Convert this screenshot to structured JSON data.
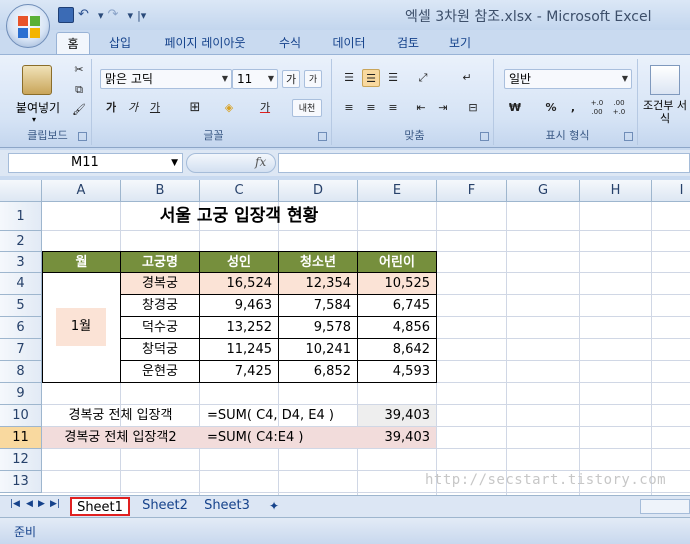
{
  "window": {
    "title": "엑셀 3차원 참조.xlsx - Microsoft Excel"
  },
  "ribbon_tabs": [
    {
      "label": "홈"
    },
    {
      "label": "삽입"
    },
    {
      "label": "페이지 레이아웃"
    },
    {
      "label": "수식"
    },
    {
      "label": "데이터"
    },
    {
      "label": "검토"
    },
    {
      "label": "보기"
    }
  ],
  "ribbon": {
    "clipboard": {
      "paste_label": "붙여넣기",
      "group_label": "클립보드"
    },
    "font": {
      "font_name": "맑은 고딕",
      "font_size": "11",
      "group_label": "글꼴",
      "bold": "가",
      "italic": "가",
      "underline": "가",
      "grow": "가",
      "shrink": "가",
      "phonetic": "내천"
    },
    "alignment": {
      "group_label": "맞춤"
    },
    "number": {
      "format": "일반",
      "group_label": "표시 형식",
      "currency": "₩",
      "percent": "%",
      "comma": ",",
      "inc_dec": "+.0 .00",
      "dec_dec": ".00 +.0"
    },
    "styles": {
      "cond_format": "조건부 서식"
    }
  },
  "formula_bar": {
    "name_box": "M11",
    "fx": "fx",
    "content": ""
  },
  "columns": [
    "A",
    "B",
    "C",
    "D",
    "E",
    "F",
    "G",
    "H",
    "I"
  ],
  "rows": [
    "1",
    "2",
    "3",
    "4",
    "5",
    "6",
    "7",
    "8",
    "9",
    "10",
    "11",
    "12",
    "13"
  ],
  "sheet": {
    "title": "서울 고궁 입장객 현황",
    "headers": [
      "월",
      "고궁명",
      "성인",
      "청소년",
      "어린이"
    ],
    "month": "1월",
    "data": [
      {
        "name": "경복궁",
        "adult": "16,524",
        "youth": "12,354",
        "child": "10,525"
      },
      {
        "name": "창경궁",
        "adult": "9,463",
        "youth": "7,584",
        "child": "6,745"
      },
      {
        "name": "덕수궁",
        "adult": "13,252",
        "youth": "9,578",
        "child": "4,856"
      },
      {
        "name": "창덕궁",
        "adult": "11,245",
        "youth": "10,241",
        "child": "8,642"
      },
      {
        "name": "운현궁",
        "adult": "7,425",
        "youth": "6,852",
        "child": "4,593"
      }
    ],
    "row10": {
      "label": "경복궁 전체 입장객",
      "formula": "=SUM( C4, D4, E4 )",
      "value": "39,403"
    },
    "row11": {
      "label": "경복궁 전체 입장객2",
      "formula": "=SUM( C4:E4 )",
      "value": "39,403"
    }
  },
  "sheet_tabs": [
    {
      "label": "Sheet1"
    },
    {
      "label": "Sheet2"
    },
    {
      "label": "Sheet3"
    }
  ],
  "watermark": "http://secstart.tistory.com",
  "status": {
    "ready": "준비"
  },
  "colors": {
    "header_green": "#768f3d",
    "highlight_pink": "#fbe3d6",
    "row11_pink": "#f2dcdb",
    "active_tab_border": "#e02020"
  }
}
